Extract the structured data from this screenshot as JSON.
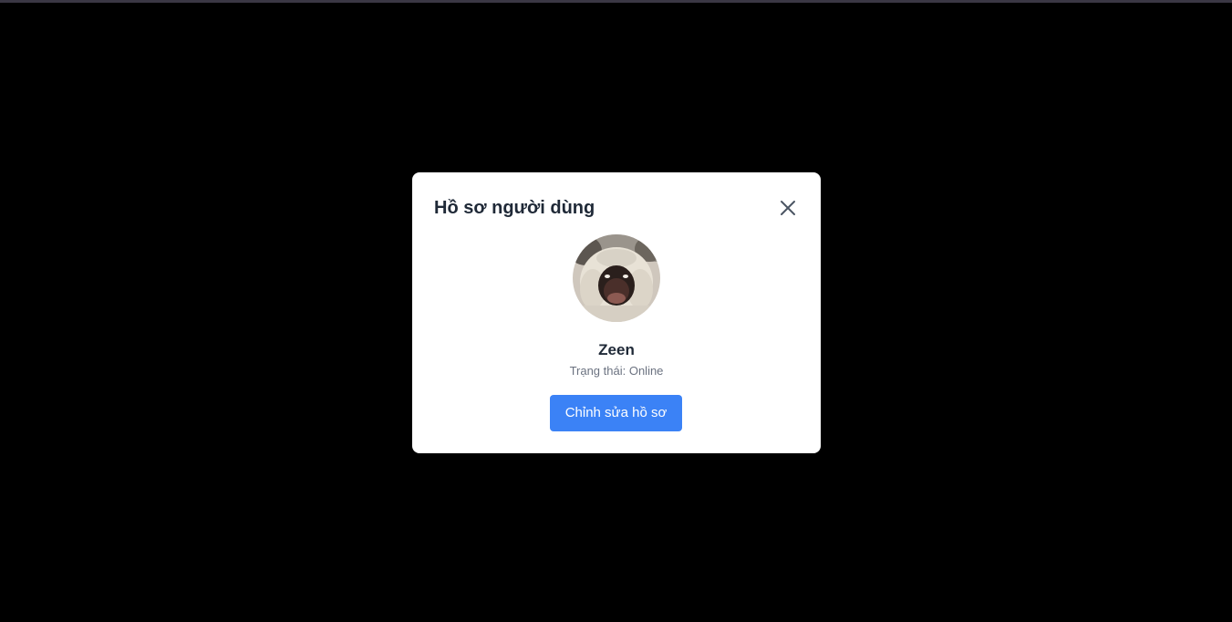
{
  "modal": {
    "title": "Hồ sơ người dùng",
    "close_icon": "close-icon"
  },
  "profile": {
    "avatar_icon": "avatar-photo",
    "name": "Zeen",
    "status_label": "Trạng thái:",
    "status_value": "Online",
    "status_text": "Trạng thái: Online"
  },
  "actions": {
    "edit_label": "Chỉnh sửa hồ sơ"
  },
  "colors": {
    "backdrop": "#000000",
    "modal_bg": "#ffffff",
    "title_text": "#1f2937",
    "muted_text": "#6b7280",
    "primary_button": "#3b82f6",
    "close_icon": "#4b5563"
  }
}
